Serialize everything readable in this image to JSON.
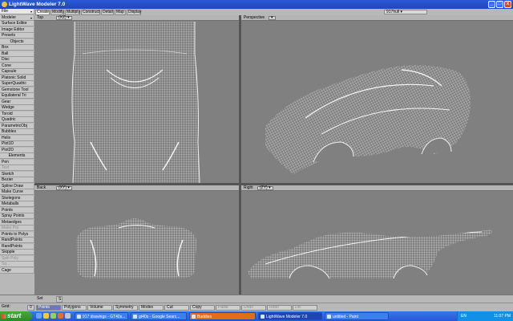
{
  "window": {
    "title": "LightWave Modeler 7.0",
    "min": "_",
    "max": "□",
    "close": "x"
  },
  "left_panel": {
    "top_buttons": [
      "File",
      "Modeler",
      "Surface Editor",
      "Image Editor",
      "Presets"
    ],
    "objects_header": "Objects",
    "objects": [
      "Box",
      "Ball",
      "Disc",
      "Cone",
      "Capsule",
      "Platonic Solid",
      "SuperQuadric",
      "Gemstone Tool",
      "Equilateral Tri",
      "Gear",
      "Wedge",
      "Toroid",
      "Quadric",
      "ParametricObj",
      "Bubbles",
      "Helix",
      "Plot1D",
      "Plot2D"
    ],
    "elements_header": "Elements",
    "elements": [
      "Pen",
      "Text",
      "Sketch",
      "Bezier",
      "Spline Draw",
      "Make Curve",
      "Skelegons",
      "Metaballs",
      "Points",
      "Spray Points",
      "Metaedges",
      "Make Pol",
      "Points to Polys",
      "RandPoints",
      "RandPoints",
      "Skipple",
      "Split Poly",
      "Sq...",
      "Cage"
    ],
    "grid_label": "Grid:",
    "grid_value": "0"
  },
  "tabs": [
    "Create",
    "Modify",
    "Multiply",
    "Construct",
    "Detail",
    "Map",
    "Display"
  ],
  "active_tab": "Create",
  "object_name": "917hull",
  "viewports": [
    {
      "id": "top",
      "label": "Top",
      "mode": "(XZ)"
    },
    {
      "id": "perspective",
      "label": "Perspective",
      "mode": ""
    },
    {
      "id": "back",
      "label": "Back",
      "mode": "(XY)"
    },
    {
      "id": "right",
      "label": "Right",
      "mode": "(ZY)"
    }
  ],
  "set_label": "Set",
  "set_value": "S",
  "bottom_buttons": [
    "Points",
    "Polygons",
    "Volume",
    "Symmetry",
    "Modes",
    "Cut",
    "Copy",
    "Paste",
    "Undo",
    "Redo",
    "Del"
  ],
  "active_bottom": "Points",
  "layer_buttons": [
    "W",
    "T",
    "M",
    "C",
    "S"
  ],
  "surface_select": "(none)",
  "taskbar": {
    "start_label": "start",
    "tasks": [
      {
        "label": "917 drawings - GT40s...",
        "state": "normal"
      },
      {
        "label": "gt40s - Google Searc...",
        "state": "normal"
      },
      {
        "label": "Buddies",
        "state": "highlight"
      },
      {
        "label": "LightWave Modeler 7.0",
        "state": "active"
      },
      {
        "label": "untitled - Paint",
        "state": "normal"
      }
    ],
    "tray": {
      "lang": "EN",
      "time": "11:07 PM"
    }
  },
  "colors": {
    "titlebar": "#1d47c0",
    "viewport_bg": "#808080",
    "wireframe": "#e6e6e6",
    "active_button": "#6a79b6"
  }
}
